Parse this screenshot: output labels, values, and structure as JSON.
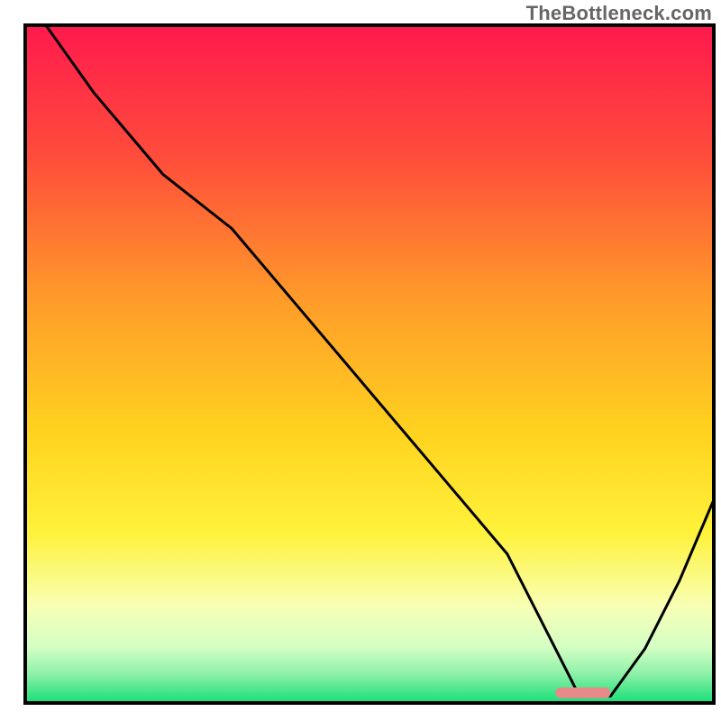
{
  "attribution": "TheBottleneck.com",
  "colors": {
    "border": "#000000",
    "curve": "#000000",
    "marker_fill": "#e68a8a",
    "gradient_stops": [
      {
        "offset": 0.0,
        "color": "#ff1a4d"
      },
      {
        "offset": 0.2,
        "color": "#ff4f3a"
      },
      {
        "offset": 0.4,
        "color": "#ff9a2a"
      },
      {
        "offset": 0.6,
        "color": "#ffd21f"
      },
      {
        "offset": 0.75,
        "color": "#fff23a"
      },
      {
        "offset": 0.86,
        "color": "#f8ffb5"
      },
      {
        "offset": 0.92,
        "color": "#d4ffc4"
      },
      {
        "offset": 0.96,
        "color": "#8cf0a8"
      },
      {
        "offset": 1.0,
        "color": "#1ee07a"
      }
    ]
  },
  "chart_data": {
    "type": "line",
    "title": "",
    "xlabel": "",
    "ylabel": "",
    "xlim": [
      0,
      100
    ],
    "ylim": [
      0,
      100
    ],
    "grid": false,
    "series": [
      {
        "name": "bottleneck-curve",
        "x": [
          3,
          10,
          20,
          30,
          40,
          50,
          60,
          70,
          77,
          80,
          85,
          90,
          95,
          100
        ],
        "values": [
          100,
          90,
          78,
          70,
          58,
          46,
          34,
          22,
          8,
          2,
          1,
          8,
          18,
          30
        ]
      }
    ],
    "trough_marker": {
      "x_start": 77,
      "x_end": 85,
      "y": 1.5
    }
  }
}
